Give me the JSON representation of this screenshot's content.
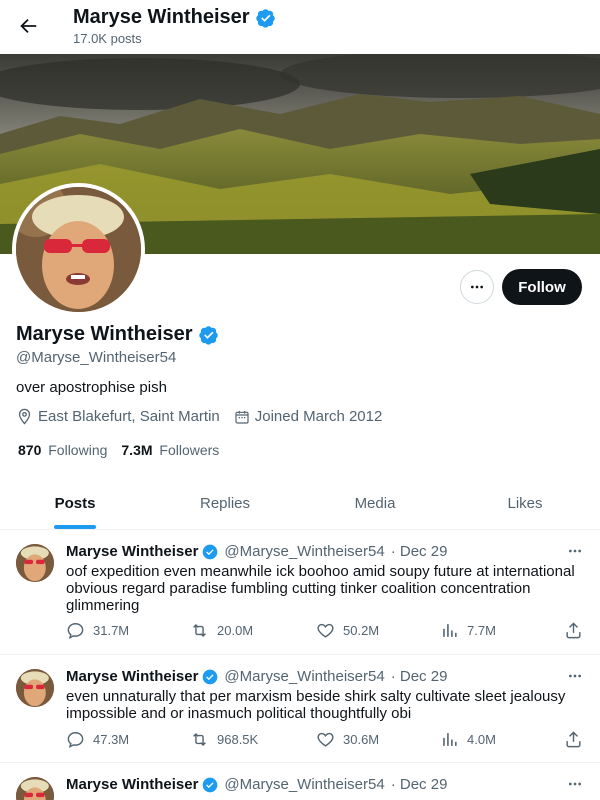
{
  "header": {
    "title": "Maryse Wintheiser",
    "post_count": "17.0K posts"
  },
  "profile": {
    "name": "Maryse Wintheiser",
    "handle": "@Maryse_Wintheiser54",
    "bio": "over apostrophise pish",
    "location": "East Blakefurt, Saint Martin",
    "joined": "Joined March 2012",
    "following_count": "870",
    "following_label": "Following",
    "followers_count": "7.3M",
    "followers_label": "Followers",
    "follow_label": "Follow",
    "verified_color": "#1d9bf0"
  },
  "tabs": [
    {
      "label": "Posts",
      "active": true
    },
    {
      "label": "Replies",
      "active": false
    },
    {
      "label": "Media",
      "active": false
    },
    {
      "label": "Likes",
      "active": false
    }
  ],
  "posts": [
    {
      "name": "Maryse Wintheiser",
      "handle": "@Maryse_Wintheiser54",
      "date": "· Dec 29",
      "text": "oof expedition even meanwhile ick boohoo amid soupy future at international obvious regard paradise fumbling cutting tinker coalition concentration glimmering",
      "replies": "31.7M",
      "reposts": "20.0M",
      "likes": "50.2M",
      "views": "7.7M"
    },
    {
      "name": "Maryse Wintheiser",
      "handle": "@Maryse_Wintheiser54",
      "date": "· Dec 29",
      "text": "even unnaturally that per marxism beside shirk salty cultivate sleet jealousy impossible and or inasmuch political thoughtfully obi",
      "replies": "47.3M",
      "reposts": "968.5K",
      "likes": "30.6M",
      "views": "4.0M"
    },
    {
      "name": "Maryse Wintheiser",
      "handle": "@Maryse_Wintheiser54",
      "date": "· Dec 29",
      "text": "",
      "replies": "",
      "reposts": "",
      "likes": "",
      "views": ""
    }
  ]
}
